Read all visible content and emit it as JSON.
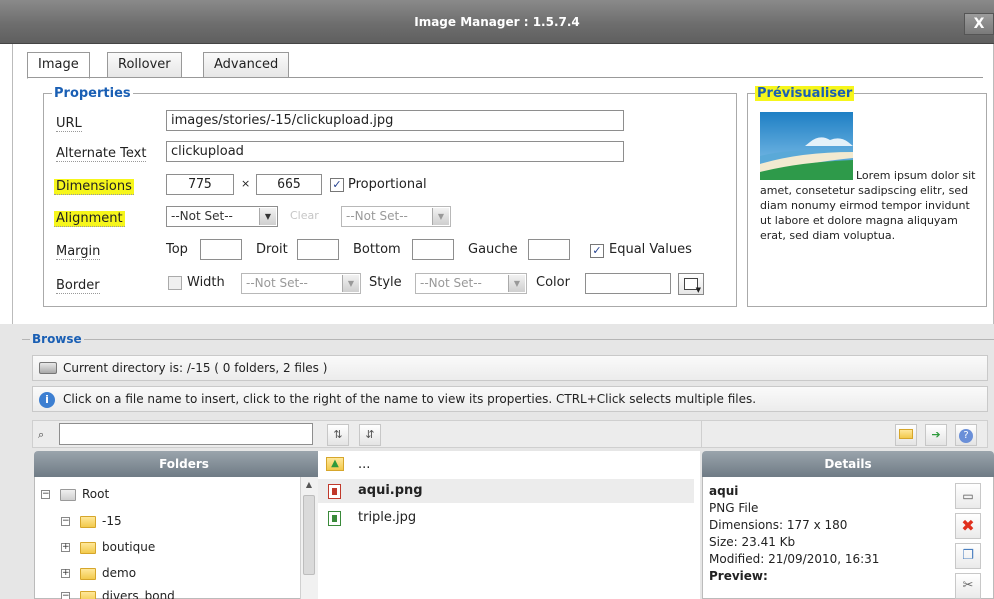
{
  "window": {
    "title": "Image Manager : 1.5.7.4",
    "close_label": "X"
  },
  "tabs": [
    {
      "label": "Image",
      "active": true
    },
    {
      "label": "Rollover",
      "active": false
    },
    {
      "label": "Advanced",
      "active": false
    }
  ],
  "properties": {
    "legend": "Properties",
    "url_label": "URL",
    "url_value": "images/stories/-15/clickupload.jpg",
    "alt_label": "Alternate Text",
    "alt_value": "clickupload",
    "dimensions_label": "Dimensions",
    "width_value": "775",
    "times_sign": "×",
    "height_value": "665",
    "proportional_label": "Proportional",
    "proportional_checked": true,
    "alignment_label": "Alignment",
    "alignment_value": "--Not Set--",
    "clear_label": "Clear",
    "clear_value": "--Not Set--",
    "margin_label": "Margin",
    "margin_top_label": "Top",
    "margin_right_label": "Droit",
    "margin_bottom_label": "Bottom",
    "margin_left_label": "Gauche",
    "equal_values_label": "Equal Values",
    "equal_values_checked": true,
    "border_label": "Border",
    "border_width_label": "Width",
    "border_width_value": "--Not Set--",
    "border_style_label": "Style",
    "border_style_value": "--Not Set--",
    "border_color_label": "Color"
  },
  "preview": {
    "legend": "Prévisualiser",
    "text": "Lorem ipsum dolor sit amet, consetetur sadipscing elitr, sed diam nonumy eirmod tempor invidunt ut labore et dolore magna aliquyam erat, sed diam voluptua."
  },
  "browse": {
    "legend": "Browse",
    "current_dir": "Current directory is: /-15 ( 0 folders, 2 files )",
    "info": "Click on a file name to insert, click to the right of the name to view its properties. CTRL+Click selects multiple files.",
    "search_value": ""
  },
  "folders": {
    "header": "Folders",
    "items": [
      {
        "label": "Root",
        "pm": "−",
        "gray": true
      },
      {
        "label": "-15",
        "pm": "−",
        "gray": false
      },
      {
        "label": "boutique",
        "pm": "+",
        "gray": false
      },
      {
        "label": "demo",
        "pm": "+",
        "gray": false
      },
      {
        "label": "divers_bond",
        "pm": "−",
        "gray": false
      }
    ]
  },
  "files": {
    "up_label": "...",
    "items": [
      {
        "name": "aqui.png",
        "selected": true,
        "type_color": "#c0392b"
      },
      {
        "name": "triple.jpg",
        "selected": false,
        "type_color": "#3a8a3a"
      }
    ]
  },
  "details": {
    "header": "Details",
    "name": "aqui",
    "type": "PNG File",
    "dimensions": "Dimensions: 177 x 180",
    "size": "Size: 23.41 Kb",
    "modified": "Modified: 21/09/2010, 16:31",
    "preview_label": "Preview:"
  },
  "colors": {
    "highlight": "#f6f61b",
    "legend_blue": "#1a5fb4",
    "delete_red": "#e0301e"
  }
}
